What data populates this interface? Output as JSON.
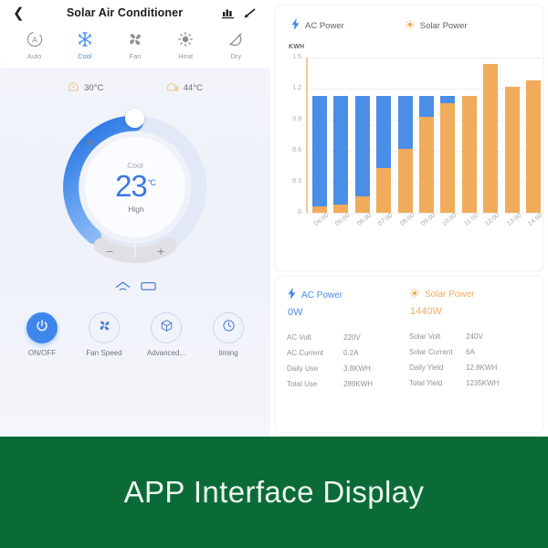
{
  "header": {
    "back_icon": "chevron-left-icon",
    "title": "Solar Air Conditioner",
    "chart_icon": "bar-chart-icon",
    "edit_icon": "pencil-icon"
  },
  "modes": [
    {
      "label": "Auto",
      "icon": "auto-circle-icon",
      "active": false
    },
    {
      "label": "Cool",
      "icon": "snowflake-icon",
      "active": true
    },
    {
      "label": "Fan",
      "icon": "fan-blades-icon",
      "active": false
    },
    {
      "label": "Heat",
      "icon": "sun-rays-icon",
      "active": false
    },
    {
      "label": "Dry",
      "icon": "dry-slash-icon",
      "active": false
    }
  ],
  "temps": {
    "indoor": {
      "icon": "house-thermometer-icon",
      "value": "30°C"
    },
    "outdoor": {
      "icon": "house-outdoor-icon",
      "value": "44°C"
    }
  },
  "dial": {
    "mode_label": "Cool",
    "temperature": "23",
    "unit": "°C",
    "fan_icon": "fan-small-icon",
    "fan_level": "High",
    "minus_label": "−",
    "plus_label": "+",
    "arc_color": "#3f86ec",
    "track_color": "#e2e8f5",
    "progress": 0.42
  },
  "swing": {
    "vertical_icon": "swing-vertical-icon",
    "horizontal_icon": "swing-horizontal-icon"
  },
  "actions": [
    {
      "label": "ON/OFF",
      "icon": "power-icon",
      "on": true
    },
    {
      "label": "Fan Speed",
      "icon": "fan-blades-icon",
      "on": false
    },
    {
      "label": "Advanced...",
      "icon": "cube-icon",
      "on": false
    },
    {
      "label": "timing",
      "icon": "clock-icon",
      "on": false
    }
  ],
  "legend": [
    {
      "label": "AC Power",
      "icon": "lightning-icon",
      "color": "#4a8ee8"
    },
    {
      "label": "Solar Power",
      "icon": "sun-icon",
      "color": "#f0ac5a"
    }
  ],
  "chart_data": {
    "type": "bar",
    "title": "",
    "subtype": "stacked",
    "xlabel": "",
    "ylabel": "KWH",
    "unit_label": "KWH",
    "grid": true,
    "legend_position": "top",
    "ylim": [
      0,
      1.5
    ],
    "yticks": [
      "1.5",
      "1.2",
      "0.9",
      "0.6",
      "0.3",
      "0"
    ],
    "ytick_values": [
      1.5,
      1.2,
      0.9,
      0.6,
      0.3,
      0
    ],
    "categories": [
      "04:00",
      "05:00",
      "06:00",
      "07:00",
      "08:00",
      "09:00",
      "10:00",
      "11:00",
      "12:00",
      "13:00",
      "14:00"
    ],
    "series": [
      {
        "name": "Solar Power",
        "color": "#f0ac5a",
        "values": [
          0.06,
          0.08,
          0.16,
          0.43,
          0.62,
          0.93,
          1.06,
          1.13,
          1.44,
          1.22,
          1.28
        ]
      },
      {
        "name": "AC Power",
        "color": "#4a8ee8",
        "values": [
          1.07,
          1.05,
          0.97,
          0.7,
          0.51,
          0.2,
          0.07,
          0.0,
          0.0,
          0.0,
          0.0
        ]
      }
    ],
    "totals": [
      1.13,
      1.13,
      1.13,
      1.13,
      1.13,
      1.13,
      1.13,
      1.13,
      1.44,
      1.22,
      1.28
    ]
  },
  "stats": {
    "ac": {
      "icon": "lightning-icon",
      "title": "AC Power",
      "value": "0W",
      "rows": [
        {
          "key": "AC  Volt",
          "val": "220V"
        },
        {
          "key": "AC Current",
          "val": "0.2A"
        },
        {
          "key": "Daily Use",
          "val": "3.8KWH"
        },
        {
          "key": "Total Use",
          "val": "289KWH"
        }
      ]
    },
    "solar": {
      "icon": "sun-icon",
      "title": "Solar Power",
      "value": "1440W",
      "rows": [
        {
          "key": "Solar Volt",
          "val": "240V"
        },
        {
          "key": "Solar Current",
          "val": "6A"
        },
        {
          "key": "Daily Yield",
          "val": "12.8KWH"
        },
        {
          "key": "Total Yield",
          "val": "1235KWH"
        }
      ]
    }
  },
  "footer": {
    "text": "APP Interface Display",
    "bg_color": "#0b6b36"
  }
}
